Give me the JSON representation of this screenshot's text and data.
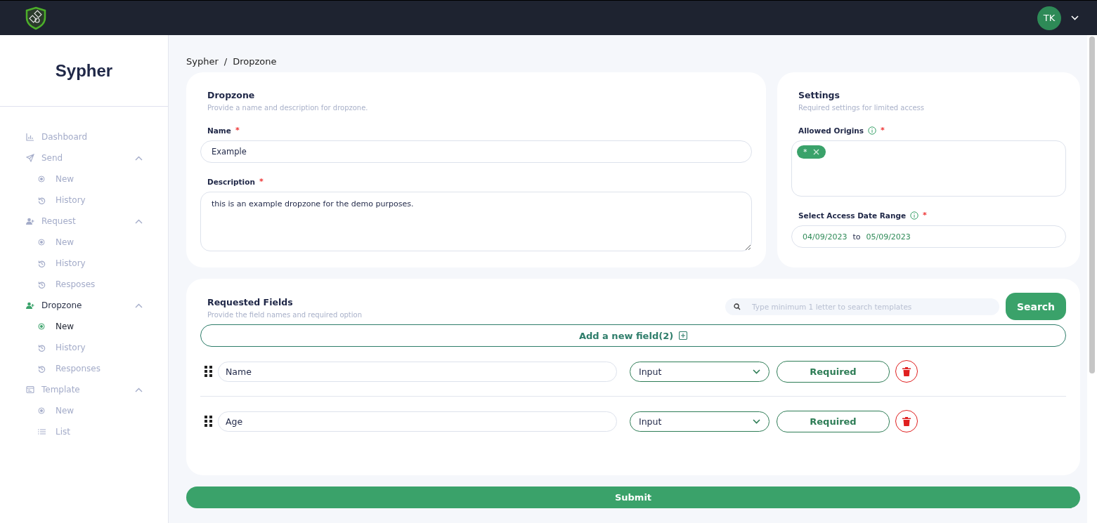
{
  "topbar": {
    "avatar": "TK"
  },
  "sidebar": {
    "brand": "Sypher",
    "items": [
      {
        "label": "Dashboard",
        "kind": "chart",
        "selected": false
      },
      {
        "label": "Send",
        "kind": "send",
        "selected": false,
        "expanded": true,
        "children": [
          {
            "label": "New",
            "kind": "new",
            "selected": false
          },
          {
            "label": "History",
            "kind": "history",
            "selected": false
          }
        ]
      },
      {
        "label": "Request",
        "kind": "user",
        "selected": false,
        "expanded": true,
        "children": [
          {
            "label": "New",
            "kind": "new",
            "selected": false
          },
          {
            "label": "History",
            "kind": "history",
            "selected": false
          },
          {
            "label": "Resposes",
            "kind": "history",
            "selected": false
          }
        ]
      },
      {
        "label": "Dropzone",
        "kind": "user",
        "selected": true,
        "expanded": true,
        "children": [
          {
            "label": "New",
            "kind": "new",
            "selected": true
          },
          {
            "label": "History",
            "kind": "history",
            "selected": false
          },
          {
            "label": "Responses",
            "kind": "history",
            "selected": false
          }
        ]
      },
      {
        "label": "Template",
        "kind": "template",
        "selected": false,
        "expanded": true,
        "children": [
          {
            "label": "New",
            "kind": "new",
            "selected": false
          },
          {
            "label": "List",
            "kind": "list",
            "selected": false
          }
        ]
      }
    ]
  },
  "breadcrumb": [
    "Sypher",
    "/",
    "Dropzone"
  ],
  "dropzone": {
    "title": "Dropzone",
    "subtitle": "Provide a name and description for dropzone.",
    "name_label": "Name",
    "name_value": "Example",
    "description_label": "Description",
    "description_value": "this is an example dropzone for the demo purposes.",
    "required_mark": "*"
  },
  "settings": {
    "title": "Settings",
    "subtitle": "Required settings for limited access",
    "origins_label": "Allowed Origins",
    "origins": [
      "*"
    ],
    "date_label": "Select Access Date Range",
    "date_from": "04/09/2023",
    "date_sep": "to",
    "date_to": "05/09/2023",
    "required_mark": "*"
  },
  "requested_fields": {
    "title": "Requested Fields",
    "subtitle": "Provide the field names and required option",
    "search_placeholder": "Type minimum 1 letter to search templates",
    "search_button": "Search",
    "add_button": "Add a new field(2)",
    "fields": [
      {
        "name": "Name",
        "type": "Input",
        "required_label": "Required"
      },
      {
        "name": "Age",
        "type": "Input",
        "required_label": "Required"
      }
    ]
  },
  "submit": "Submit"
}
